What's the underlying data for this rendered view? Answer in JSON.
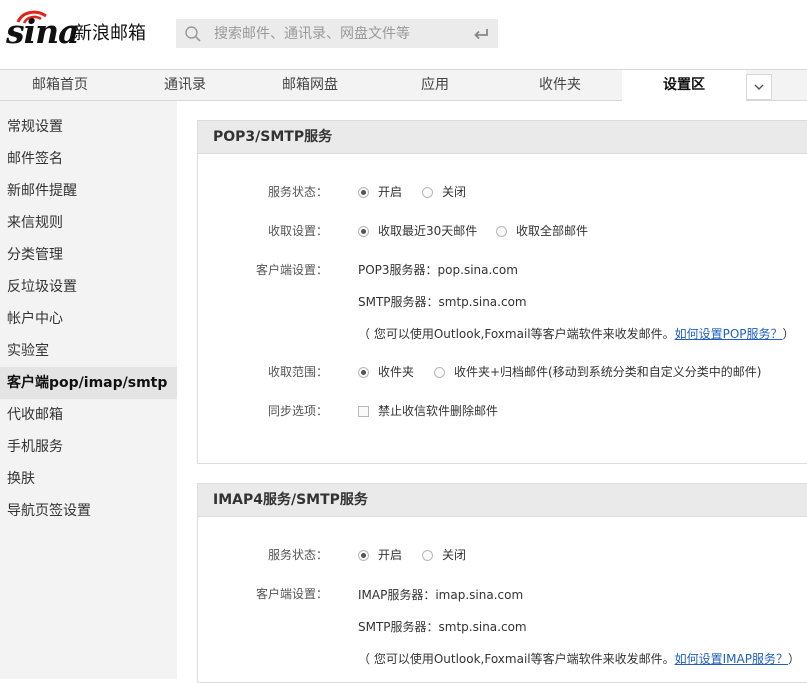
{
  "header": {
    "logo_text": "sina",
    "logo_cn": "新浪邮箱",
    "search_placeholder": "搜索邮件、通讯录、网盘文件等"
  },
  "nav": {
    "tabs": [
      {
        "label": "邮箱首页"
      },
      {
        "label": "通讯录"
      },
      {
        "label": "邮箱网盘"
      },
      {
        "label": "应用"
      },
      {
        "label": "收件夹"
      },
      {
        "label": "设置区",
        "active": true
      }
    ]
  },
  "sidebar": {
    "items": [
      {
        "label": "常规设置"
      },
      {
        "label": "邮件签名"
      },
      {
        "label": "新邮件提醒"
      },
      {
        "label": "来信规则"
      },
      {
        "label": "分类管理"
      },
      {
        "label": "反垃圾设置"
      },
      {
        "label": "帐户中心"
      },
      {
        "label": "实验室"
      },
      {
        "label": "客户端pop/imap/smtp",
        "active": true
      },
      {
        "label": "代收邮箱"
      },
      {
        "label": "手机服务"
      },
      {
        "label": "换肤"
      },
      {
        "label": "导航页签设置"
      }
    ]
  },
  "pop3": {
    "title": "POP3/SMTP服务",
    "status_label": "服务状态：",
    "status_on": "开启",
    "status_off": "关闭",
    "status_value": "开启",
    "fetch_label": "收取设置：",
    "fetch_recent": "收取最近30天邮件",
    "fetch_all": "收取全部邮件",
    "fetch_value": "收取最近30天邮件",
    "client_label": "客户端设置：",
    "pop_server": "POP3服务器：pop.sina.com",
    "smtp_server": "SMTP服务器：smtp.sina.com",
    "note_prefix": "（ 您可以使用Outlook,Foxmail等客户端软件来收发邮件。",
    "note_link": "如何设置POP服务？",
    "note_suffix": "）",
    "range_label": "收取范围：",
    "range_inbox": "收件夹",
    "range_all": "收件夹+归档邮件(移动到系统分类和自定义分类中的邮件)",
    "range_value": "收件夹",
    "sync_label": "同步选项：",
    "sync_option": "禁止收信软件删除邮件",
    "sync_checked": false
  },
  "imap": {
    "title": "IMAP4服务/SMTP服务",
    "status_label": "服务状态：",
    "status_on": "开启",
    "status_off": "关闭",
    "status_value": "开启",
    "client_label": "客户端设置：",
    "imap_server": "IMAP服务器：imap.sina.com",
    "smtp_server": "SMTP服务器：smtp.sina.com",
    "note_prefix": "（ 您可以使用Outlook,Foxmail等客户端软件来收发邮件。",
    "note_link": "如何设置IMAP服务？",
    "note_suffix": "）"
  },
  "colors": {
    "link": "#1f5fbf",
    "sidebar_bg": "#f3f3f3",
    "panel_head_bg": "#eaeaea",
    "logo_red": "#e2231a"
  }
}
